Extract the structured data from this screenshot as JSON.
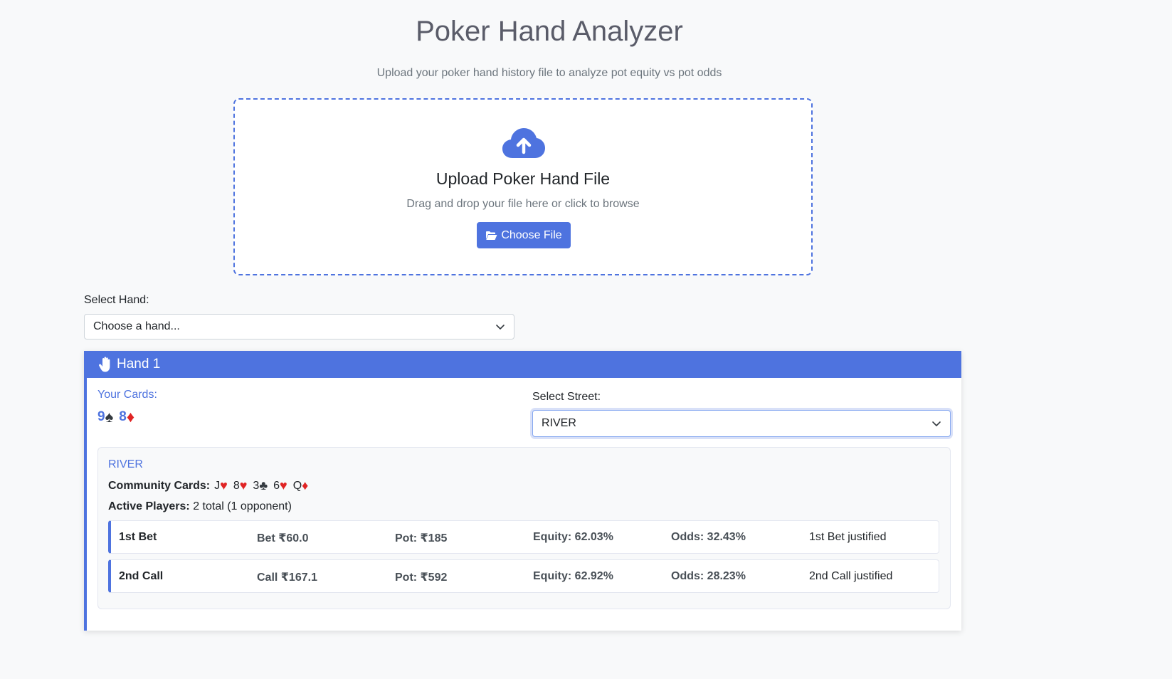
{
  "header": {
    "title": "Poker Hand Analyzer",
    "subtitle": "Upload your poker hand history file to analyze pot equity vs pot odds"
  },
  "upload": {
    "icon": "cloud-upload-icon",
    "title": "Upload Poker Hand File",
    "subtitle": "Drag and drop your file here or click to browse",
    "button_label": "Choose File"
  },
  "hand_select": {
    "label": "Select Hand:",
    "value": "Choose a hand..."
  },
  "hand": {
    "title": "Hand 1",
    "your_cards_label": "Your Cards:",
    "your_cards": [
      {
        "rank": "9",
        "suit": "♠",
        "color": "black"
      },
      {
        "rank": "8",
        "suit": "♦",
        "color": "red"
      }
    ],
    "street_label": "Select Street:",
    "street_value": "RIVER",
    "street": {
      "name": "RIVER",
      "community_label": "Community Cards:",
      "community_cards": [
        {
          "rank": "J",
          "suit": "♥",
          "color": "red"
        },
        {
          "rank": "8",
          "suit": "♥",
          "color": "red"
        },
        {
          "rank": "3",
          "suit": "♣",
          "color": "black"
        },
        {
          "rank": "6",
          "suit": "♥",
          "color": "red"
        },
        {
          "rank": "Q",
          "suit": "♦",
          "color": "red"
        }
      ],
      "active_players_label": "Active Players:",
      "active_players_value": "2 total (1 opponent)",
      "actions": [
        {
          "name": "1st Bet",
          "amount": "Bet ₹60.0",
          "pot": "Pot: ₹185",
          "equity": "Equity: 62.03%",
          "odds": "Odds: 32.43%",
          "verdict": "1st Bet justified"
        },
        {
          "name": "2nd Call",
          "amount": "Call ₹167.1",
          "pot": "Pot: ₹592",
          "equity": "Equity: 62.92%",
          "odds": "Odds: 28.23%",
          "verdict": "2nd Call justified"
        }
      ]
    }
  },
  "colors": {
    "accent": "#4e73df",
    "red_suit": "#e02424",
    "black_suit": "#343a40"
  }
}
